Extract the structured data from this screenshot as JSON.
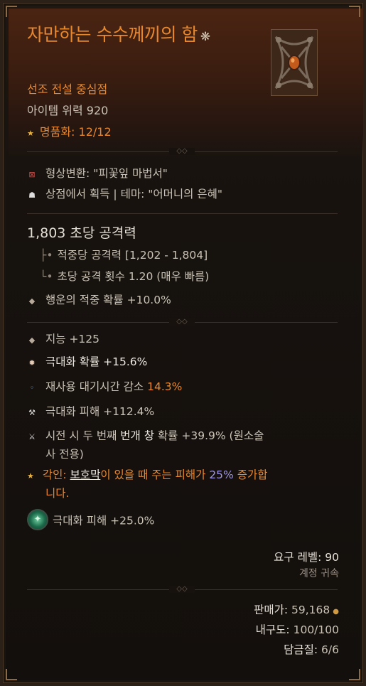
{
  "tooltip": {
    "title": "자만하는 수수께끼의 함",
    "title_star": "❋",
    "item_type": "선조 전설 중심점",
    "item_power": "아이템 위력 920",
    "masterwork": "명품화: 12/12",
    "transmog": "형상변환: \"피꽃잎 마법서\"",
    "shop": "상점에서 획득 | 테마: \"어머니의 은혜\"",
    "dps": "1,803 초당 공격력",
    "damage_per_hit": "적중당 공격력 [1,202 - 1,804]",
    "attacks_per_second": "초당 공격 횟수 1.20 (매우 빠름)",
    "luck": "행운의 적중 확률 +10.0%",
    "affixes": {
      "intelligence": "지능 +125",
      "crit_chance_label": "극대화 확률",
      "crit_chance_value": "+15.6%",
      "cdr_label": "재사용 대기시간 감소 ",
      "cdr_value": "14.3%",
      "crit_damage": "극대화 피해 +112.4%",
      "lightning_pre": "시전 시 두 번째 ",
      "lightning_strong": "번개 창",
      "lightning_post": " 확률 +39.9% (원소술",
      "lightning_line2": "사 전용)"
    },
    "legendary": {
      "prefix": "각인: ",
      "keyword": "보호막",
      "mid": "이 있을 때 주는 피해가 ",
      "value": "25%",
      "suffix": " 증가합",
      "line2": "니다."
    },
    "gem": "극대화 피해 +25.0%",
    "requires_level": "요구 레벨: 90",
    "account_bound": "계정 귀속",
    "sell_label": "판매가:",
    "sell_value": "59,168",
    "durability_label": "내구도:",
    "durability_value": "100/100",
    "temper_label": "담금질:",
    "temper_value": "6/6"
  },
  "colors": {
    "legendary_orange": "#e8882e",
    "violet": "#9f98e8",
    "gem_green": "#3fbf84"
  }
}
